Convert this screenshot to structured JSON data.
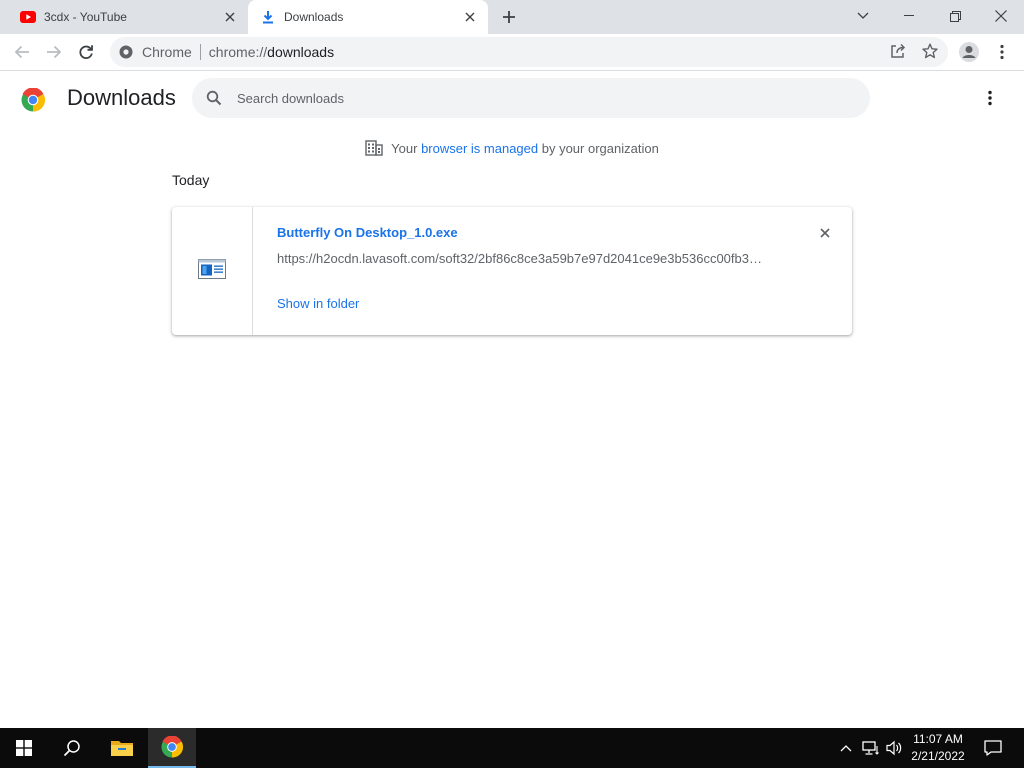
{
  "tabs": [
    {
      "title": "3cdx - YouTube",
      "icon": "youtube-icon",
      "active": false
    },
    {
      "title": "Downloads",
      "icon": "download-icon",
      "active": true
    }
  ],
  "toolbar": {
    "site_chip": "Chrome",
    "url_scheme": "chrome://",
    "url_path": "downloads"
  },
  "page": {
    "title": "Downloads",
    "search_placeholder": "Search downloads"
  },
  "managed_notice": {
    "prefix": "Your ",
    "link": "browser is managed",
    "suffix": " by your organization"
  },
  "date_heading": "Today",
  "downloads": [
    {
      "file_name": "Butterfly On Desktop_1.0.exe",
      "url": "https://h2ocdn.lavasoft.com/soft32/2bf86c8ce3a59b7e97d2041ce9e3b536cc00fb3…",
      "action": "Show in folder"
    }
  ],
  "taskbar": {
    "time": "11:07 AM",
    "date": "2/21/2022"
  },
  "colors": {
    "accent": "#1a73e8",
    "tabstrip": "#dee1e6",
    "taskbar": "#0b0b0b"
  }
}
